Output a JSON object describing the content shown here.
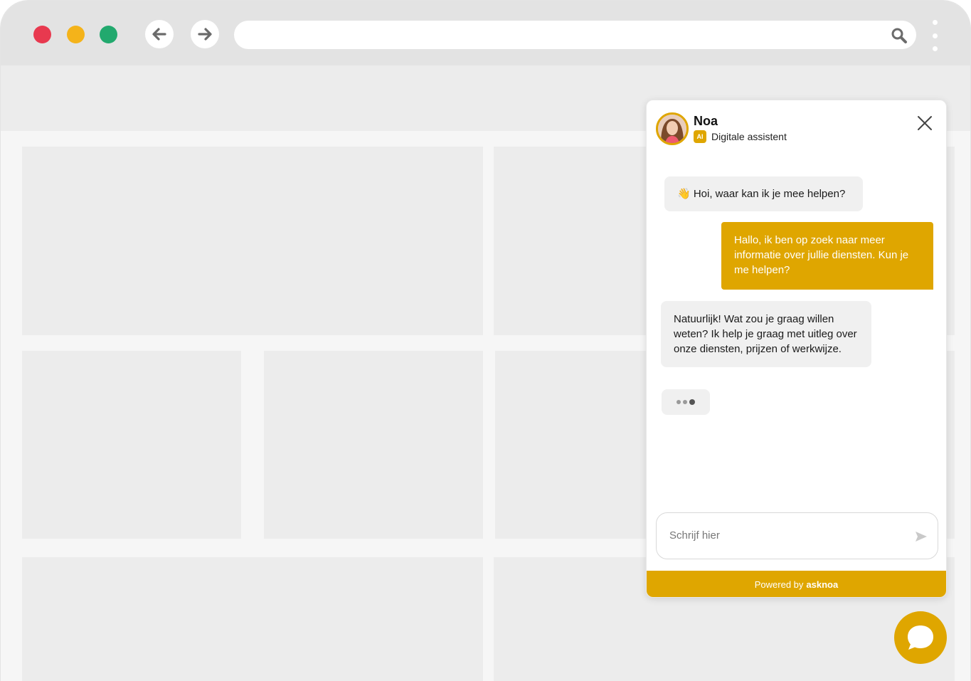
{
  "browser": {
    "url_value": "",
    "traffic_lights": {
      "close": "#e8394f",
      "minimize": "#f4b31a",
      "maximize": "#22a96e"
    },
    "icons": {
      "back": "arrow-left-icon",
      "forward": "arrow-right-icon",
      "search": "search-icon",
      "menu": "kebab-menu-icon"
    }
  },
  "chat": {
    "agent_name": "Noa",
    "badge": "AI",
    "agent_role": "Digitale assistent",
    "messages": [
      {
        "from": "bot",
        "text": "👋 Hoi, waar kan ik je mee helpen?"
      },
      {
        "from": "user",
        "text": "Hallo, ik ben op zoek naar meer informatie over jullie diensten. Kun je me helpen?"
      },
      {
        "from": "bot",
        "text": "Natuurlijk! Wat zou je graag willen weten? Ik help je graag met uitleg over onze diensten, prijzen of werkwijze."
      }
    ],
    "input_placeholder": "Schrijf hier",
    "input_value": "",
    "footer_prefix": "Powered by",
    "footer_brand": "asknoa"
  },
  "colors": {
    "accent": "#dfa600",
    "bot_bubble": "#f0f0f0",
    "placeholder_block": "#ececec"
  }
}
